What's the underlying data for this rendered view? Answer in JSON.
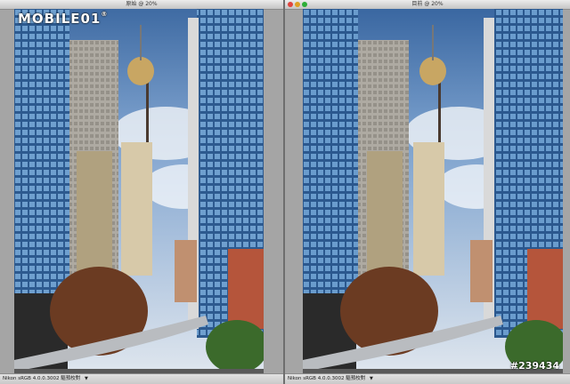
{
  "watermark": {
    "brand": "MOBILE01",
    "registered": "®"
  },
  "photo_id": "#239434",
  "left_window": {
    "title": "原始 @ 20%",
    "status": "Nikon sRGB 4.0.0.3002  驅預校對"
  },
  "right_window": {
    "title": "目前 @ 20%",
    "status": "Nikon sRGB 4.0.0.3002  驅預校對"
  },
  "icons": {
    "close": "close-icon",
    "minimize": "minimize-icon",
    "zoom": "zoom-icon",
    "status_menu": "triangle-down-icon"
  },
  "colors": {
    "sky": "#4c6f9f",
    "glass_tower": "#3c6fa2",
    "tree": "#6b3b22",
    "monorail": "#b9bcc0"
  }
}
